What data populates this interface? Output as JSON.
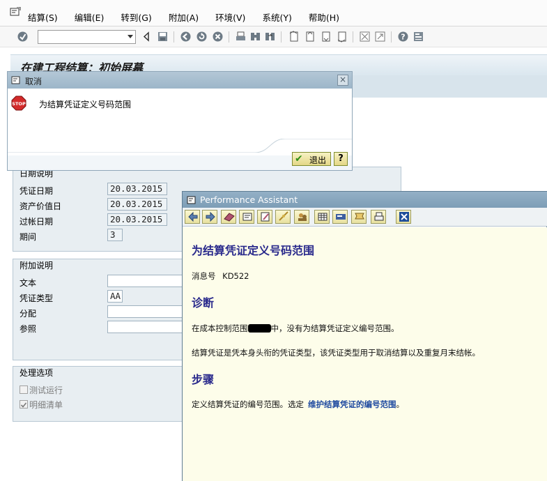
{
  "menubar": {
    "items": [
      "结算(S)",
      "编辑(E)",
      "转到(G)",
      "附加(A)",
      "环境(V)",
      "系统(Y)",
      "帮助(H)"
    ]
  },
  "toolbar": {
    "command_value": ""
  },
  "screen": {
    "title": "在建工程结算：初始屏幕"
  },
  "date_section": {
    "title": "日期说明",
    "fields": [
      {
        "label": "凭证日期",
        "value": "20.03.2015"
      },
      {
        "label": "资产价值日",
        "value": "20.03.2015"
      },
      {
        "label": "过帐日期",
        "value": "20.03.2015"
      },
      {
        "label": "期间",
        "value": "3"
      }
    ]
  },
  "extra_section": {
    "title": "附加说明",
    "fields": [
      {
        "label": "文本",
        "value": ""
      },
      {
        "label": "凭证类型",
        "value": "AA"
      },
      {
        "label": "分配",
        "value": ""
      },
      {
        "label": "参照",
        "value": ""
      }
    ]
  },
  "process_section": {
    "title": "处理选项",
    "options": [
      {
        "label": "测试运行",
        "checked": false
      },
      {
        "label": "明细清单",
        "checked": true
      }
    ]
  },
  "cancel_dialog": {
    "title": "取消",
    "message": "为结算凭证定义号码范围",
    "exit_label": "退出"
  },
  "performance_assistant": {
    "title": "Performance Assistant",
    "heading": "为结算凭证定义号码范围",
    "message_number_label": "消息号",
    "message_number": "KD522",
    "diagnosis_heading": "诊断",
    "diagnosis_line1_pre": "在成本控制范围",
    "diagnosis_line1_post": "中，没有为结算凭证定义编号范围。",
    "diagnosis_line2": "结算凭证是凭本身头衔的凭证类型，该凭证类型用于取消结算以及重复月末结帐。",
    "steps_heading": "步骤",
    "steps_pre": "定义结算凭证的编号范围。选定",
    "steps_link": "维护结算凭证的编号范围",
    "steps_post": "。"
  }
}
